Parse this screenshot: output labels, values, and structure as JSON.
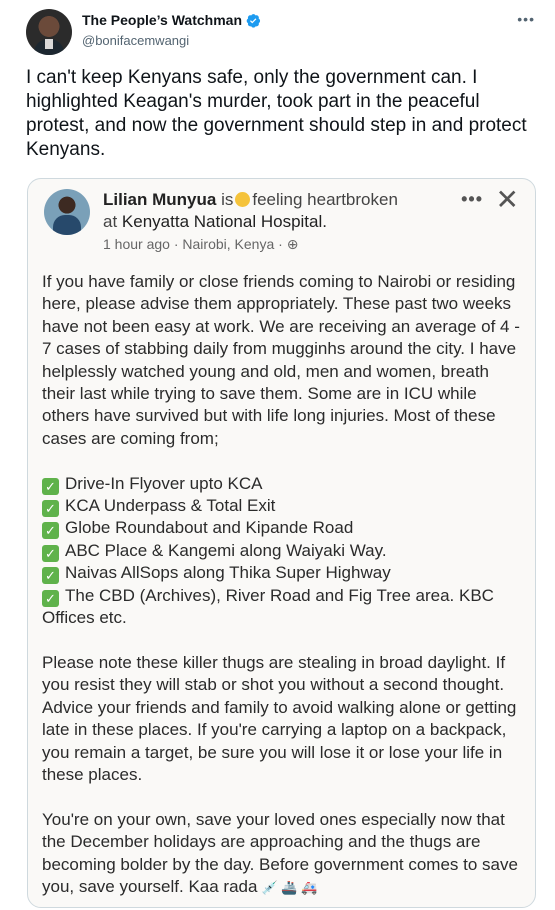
{
  "tweet": {
    "display_name": "The People’s Watchman",
    "handle": "@bonifacemwangi",
    "more_icon": "more-dots-icon",
    "text": "I can't keep Kenyans safe, only the government can. I highlighted Keagan's murder, took part in the peaceful protest, and now the government should step in and protect Kenyans."
  },
  "fb_post": {
    "author": "Lilian Munyua",
    "feeling_prefix": "is",
    "feeling": "feeling heartbroken",
    "at_prefix": "at",
    "location": "Kenyatta National Hospital.",
    "time": "1 hour ago",
    "place": "Nairobi, Kenya",
    "paragraph1": "If you have family or close friends coming to Nairobi or residing here, please advise them appropriately. These past two weeks have not been easy at work. We are receiving an average of 4 - 7 cases of stabbing daily from mugginhs around the city. I have helplessly watched young and old, men and women, breath their last while trying to save them. Some are in ICU while others have survived but with life long injuries. Most of these cases are coming from;",
    "locations": [
      "Drive-In Flyover upto KCA",
      "KCA Underpass & Total Exit",
      "Globe Roundabout and Kipande Road",
      "ABC Place & Kangemi along Waiyaki Way.",
      "Naivas AllSops along Thika Super Highway",
      "The CBD (Archives), River Road and Fig Tree area. KBC Offices etc."
    ],
    "paragraph2": "Please note these killer thugs are stealing in broad daylight. If you resist they will stab or shot you without a second thought. Advice your friends and family to avoid walking alone or getting late in these places. If you're carrying a laptop on a backpack, you remain a target, be sure you will lose it or lose your life in these places.",
    "paragraph3": "You're on your own, save your loved ones especially now that the December holidays are approaching and the thugs are becoming bolder by the day. Before government comes to save you, save yourself. Kaa rada"
  }
}
